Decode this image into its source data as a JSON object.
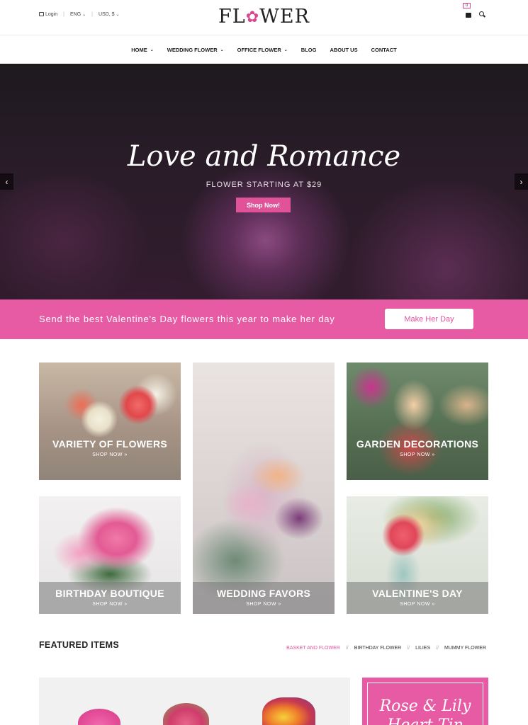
{
  "topbar": {
    "login_label": "Login",
    "language": "ENG",
    "currency": "USD, $",
    "logo_before": "FL",
    "logo_after": "WER",
    "cart_count": "0"
  },
  "nav": {
    "items": [
      {
        "label": "HOME"
      },
      {
        "label": "WEDDING FLOWER"
      },
      {
        "label": "OFFICE FLOWER"
      },
      {
        "label": "BLOG"
      },
      {
        "label": "ABOUT US"
      },
      {
        "label": "CONTACT"
      }
    ]
  },
  "hero": {
    "title": "Love and Romance",
    "subtitle": "FLOWER STARTING AT $29",
    "button_label": "Shop Now!",
    "prev_arrow": "‹",
    "next_arrow": "›"
  },
  "promo": {
    "text": "Send the best Valentine's Day flowers this year to make her day",
    "button_label": "Make Her Day"
  },
  "tiles": [
    {
      "title": "VARIETY OF FLOWERS",
      "link": "SHOP NOW »"
    },
    {
      "title": "WEDDING FAVORS",
      "link": "SHOP NOW »"
    },
    {
      "title": "GARDEN DECORATIONS",
      "link": "SHOP NOW »"
    },
    {
      "title": "BIRTHDAY BOUTIQUE",
      "link": "SHOP NOW »"
    },
    {
      "title": "VALENTINE'S DAY",
      "link": "SHOP NOW »"
    }
  ],
  "featured": {
    "title": "FEATURED ITEMS",
    "tabs": [
      {
        "label": "BASKET AND FLOWER"
      },
      {
        "label": "BIRTHDAY FLOWER"
      },
      {
        "label": "LILIES"
      },
      {
        "label": "MUMMY FLOWER"
      }
    ],
    "separator": "//"
  },
  "banner": {
    "title": "Rose & Lily",
    "subtitle": "Heart Tin"
  },
  "colors": {
    "accent": "#e75aa4",
    "button_pink": "#e05399",
    "text_dark": "#222222"
  }
}
